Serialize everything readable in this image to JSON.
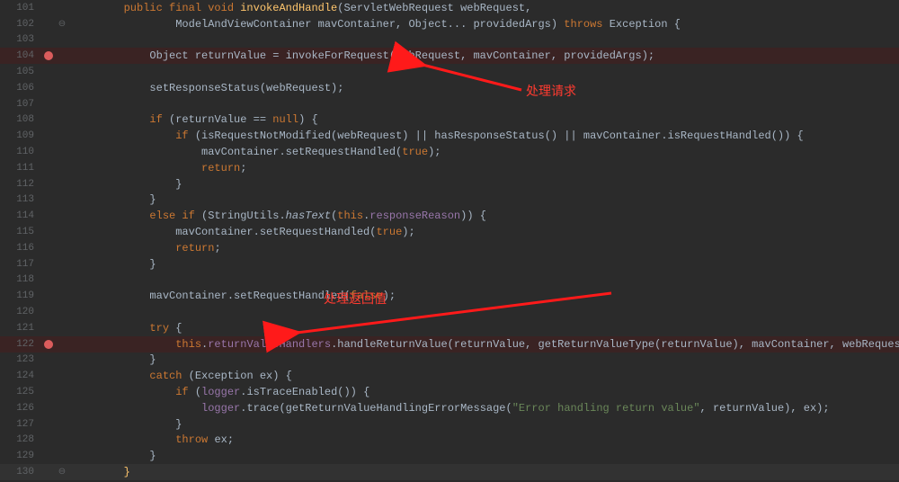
{
  "annotations": {
    "request_label": "处理请求",
    "return_label": "处理返回值"
  },
  "lines": [
    {
      "n": 101,
      "bp": false,
      "fold": "",
      "tokens": [
        [
          "        ",
          "id"
        ],
        [
          "public final void ",
          "kw"
        ],
        [
          "invokeAndHandle",
          "fn"
        ],
        [
          "(ServletWebRequest webRequest,",
          "id"
        ]
      ]
    },
    {
      "n": 102,
      "bp": false,
      "fold": "⊖",
      "tokens": [
        [
          "                ModelAndViewContainer mavContainer, Object... providedArgs) ",
          "id"
        ],
        [
          "throws ",
          "kw"
        ],
        [
          "Exception ",
          "id"
        ],
        [
          "{",
          "br"
        ]
      ]
    },
    {
      "n": 103,
      "bp": false,
      "fold": "",
      "tokens": [
        [
          "",
          "id"
        ]
      ]
    },
    {
      "n": 104,
      "bp": true,
      "fold": "",
      "tokens": [
        [
          "            Object returnValue = invokeForRequest(webRequest, mavContainer, providedArgs);",
          "id"
        ]
      ]
    },
    {
      "n": 105,
      "bp": false,
      "fold": "",
      "tokens": [
        [
          "",
          "id"
        ]
      ]
    },
    {
      "n": 106,
      "bp": false,
      "fold": "",
      "tokens": [
        [
          "            setResponseStatus(webRequest);",
          "id"
        ]
      ]
    },
    {
      "n": 107,
      "bp": false,
      "fold": "",
      "tokens": [
        [
          "",
          "id"
        ]
      ]
    },
    {
      "n": 108,
      "bp": false,
      "fold": "",
      "tokens": [
        [
          "            ",
          "id"
        ],
        [
          "if ",
          "kw"
        ],
        [
          "(returnValue == ",
          "id"
        ],
        [
          "null",
          "kw"
        ],
        [
          ") {",
          "id"
        ]
      ]
    },
    {
      "n": 109,
      "bp": false,
      "fold": "",
      "tokens": [
        [
          "                ",
          "id"
        ],
        [
          "if ",
          "kw"
        ],
        [
          "(isRequestNotModified(webRequest) || hasResponseStatus() || mavContainer.isRequestHandled()) {",
          "id"
        ]
      ]
    },
    {
      "n": 110,
      "bp": false,
      "fold": "",
      "tokens": [
        [
          "                    mavContainer.setRequestHandled(",
          "id"
        ],
        [
          "true",
          "kw"
        ],
        [
          ");",
          "id"
        ]
      ]
    },
    {
      "n": 111,
      "bp": false,
      "fold": "",
      "tokens": [
        [
          "                    ",
          "id"
        ],
        [
          "return",
          "kw"
        ],
        [
          ";",
          "id"
        ]
      ]
    },
    {
      "n": 112,
      "bp": false,
      "fold": "",
      "tokens": [
        [
          "                }",
          "id"
        ]
      ]
    },
    {
      "n": 113,
      "bp": false,
      "fold": "",
      "tokens": [
        [
          "            }",
          "id"
        ]
      ]
    },
    {
      "n": 114,
      "bp": false,
      "fold": "",
      "tokens": [
        [
          "            ",
          "id"
        ],
        [
          "else if ",
          "kw"
        ],
        [
          "(StringUtils.",
          "id"
        ],
        [
          "hasText",
          "param"
        ],
        [
          "(",
          "id"
        ],
        [
          "this",
          "kw"
        ],
        [
          ".",
          "id"
        ],
        [
          "responseReason",
          "pur"
        ],
        [
          ")) {",
          "id"
        ]
      ]
    },
    {
      "n": 115,
      "bp": false,
      "fold": "",
      "tokens": [
        [
          "                mavContainer.setRequestHandled(",
          "id"
        ],
        [
          "true",
          "kw"
        ],
        [
          ");",
          "id"
        ]
      ]
    },
    {
      "n": 116,
      "bp": false,
      "fold": "",
      "tokens": [
        [
          "                ",
          "id"
        ],
        [
          "return",
          "kw"
        ],
        [
          ";",
          "id"
        ]
      ]
    },
    {
      "n": 117,
      "bp": false,
      "fold": "",
      "tokens": [
        [
          "            }",
          "id"
        ]
      ]
    },
    {
      "n": 118,
      "bp": false,
      "fold": "",
      "tokens": [
        [
          "",
          "id"
        ]
      ]
    },
    {
      "n": 119,
      "bp": false,
      "fold": "",
      "tokens": [
        [
          "            mavContainer.setRequestHandled(",
          "id"
        ],
        [
          "false",
          "kw"
        ],
        [
          ");",
          "id"
        ]
      ]
    },
    {
      "n": 120,
      "bp": false,
      "fold": "",
      "tokens": [
        [
          "",
          "id"
        ]
      ]
    },
    {
      "n": 121,
      "bp": false,
      "fold": "",
      "tokens": [
        [
          "            ",
          "id"
        ],
        [
          "try ",
          "kw"
        ],
        [
          "{",
          "id"
        ]
      ]
    },
    {
      "n": 122,
      "bp": true,
      "fold": "",
      "tokens": [
        [
          "                ",
          "id"
        ],
        [
          "this",
          "kw"
        ],
        [
          ".",
          "id"
        ],
        [
          "returnValueHandlers",
          "pur"
        ],
        [
          ".handleReturnValue(returnValue, getReturnValueType(returnValue), mavContainer, webRequest);",
          "id"
        ]
      ]
    },
    {
      "n": 123,
      "bp": false,
      "fold": "",
      "tokens": [
        [
          "            }",
          "id"
        ]
      ]
    },
    {
      "n": 124,
      "bp": false,
      "fold": "",
      "tokens": [
        [
          "            ",
          "id"
        ],
        [
          "catch ",
          "kw"
        ],
        [
          "(Exception ex) {",
          "id"
        ]
      ]
    },
    {
      "n": 125,
      "bp": false,
      "fold": "",
      "tokens": [
        [
          "                ",
          "id"
        ],
        [
          "if ",
          "kw"
        ],
        [
          "(",
          "id"
        ],
        [
          "logger",
          "pur"
        ],
        [
          ".isTraceEnabled()) {",
          "id"
        ]
      ]
    },
    {
      "n": 126,
      "bp": false,
      "fold": "",
      "tokens": [
        [
          "                    ",
          "id"
        ],
        [
          "logger",
          "pur"
        ],
        [
          ".trace(getReturnValueHandlingErrorMessage(",
          "id"
        ],
        [
          "\"Error handling return value\"",
          "str"
        ],
        [
          ", returnValue), ex);",
          "id"
        ]
      ]
    },
    {
      "n": 127,
      "bp": false,
      "fold": "",
      "tokens": [
        [
          "                }",
          "id"
        ]
      ]
    },
    {
      "n": 128,
      "bp": false,
      "fold": "",
      "tokens": [
        [
          "                ",
          "id"
        ],
        [
          "throw ",
          "kw"
        ],
        [
          "ex;",
          "id"
        ]
      ]
    },
    {
      "n": 129,
      "bp": false,
      "fold": "",
      "tokens": [
        [
          "            }",
          "id"
        ]
      ]
    },
    {
      "n": 130,
      "bp": false,
      "fold": "⊖",
      "last": true,
      "tokens": [
        [
          "        ",
          "id"
        ],
        [
          "}",
          "gold"
        ]
      ]
    }
  ]
}
